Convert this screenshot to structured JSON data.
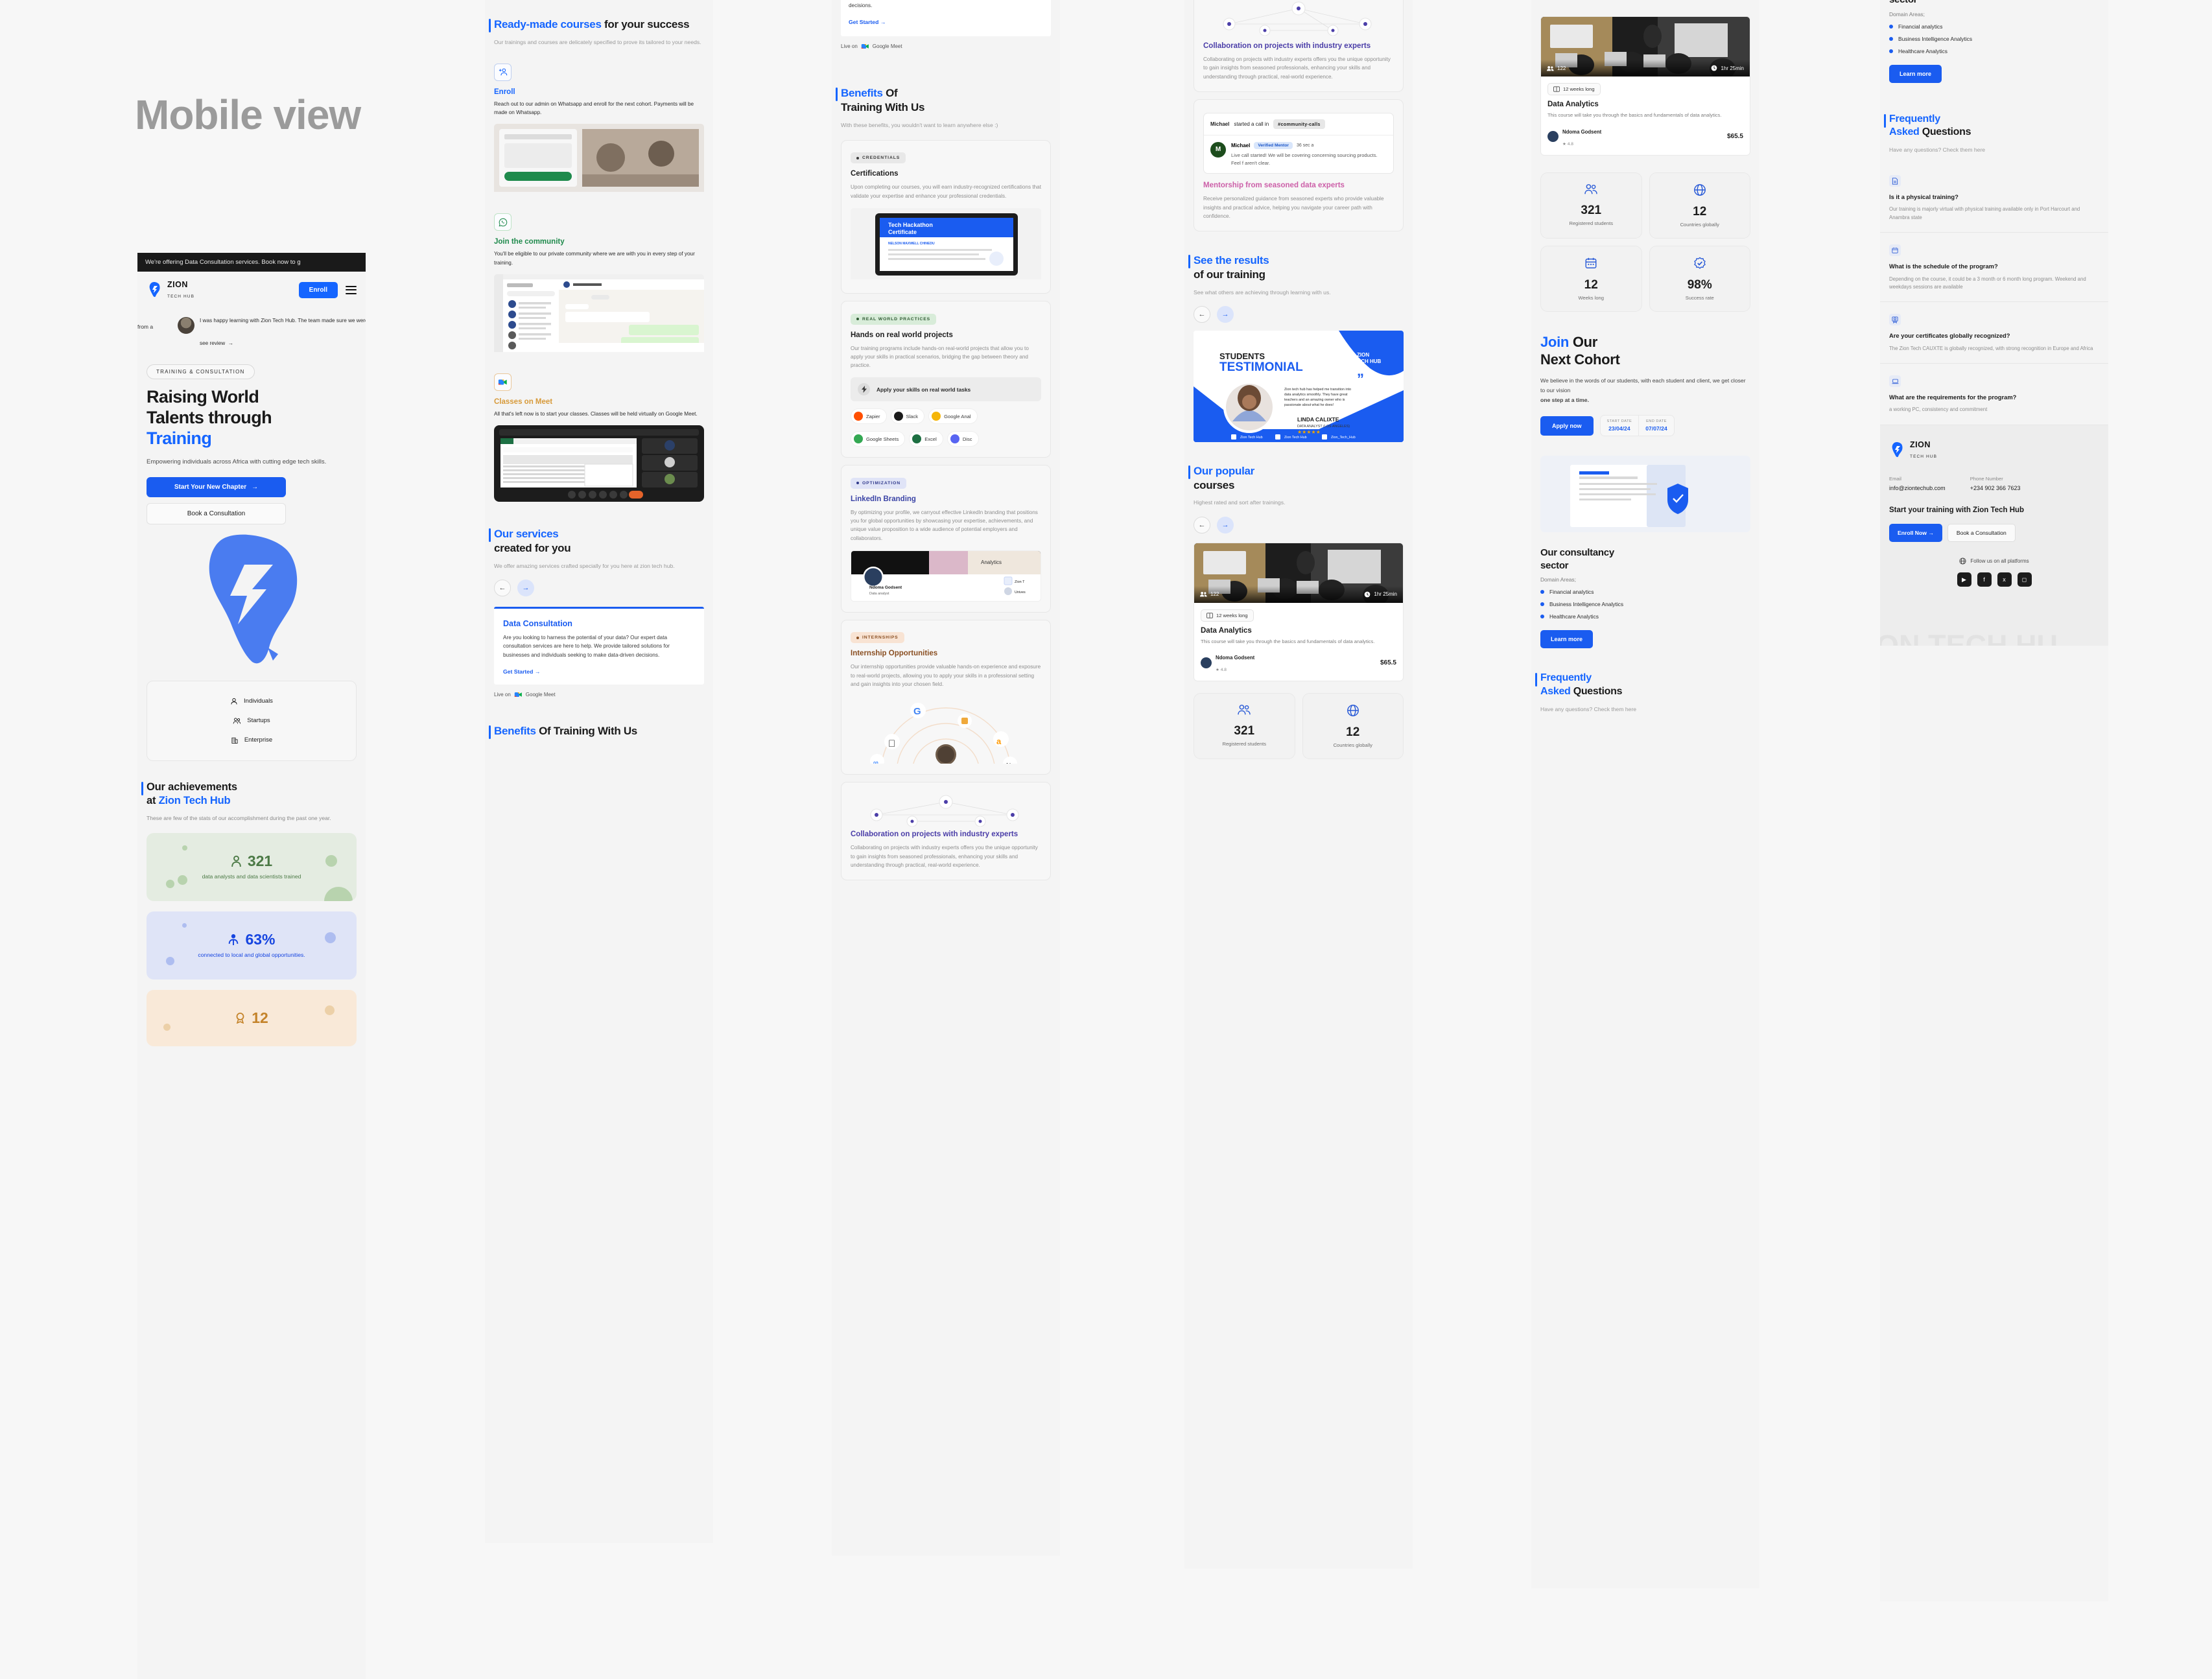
{
  "page_label": "Mobile view",
  "brand": {
    "name_line1": "ZION",
    "name_line2": "TECH HUB",
    "accent": "#1565ff"
  },
  "screen1": {
    "announcement": "We're offering Data Consultation services. Book now to g",
    "nav": {
      "enroll": "Enroll",
      "menu": "menu-icon"
    },
    "review": {
      "left_fragment": "from a",
      "quote": "I  was happy learning with Zion Tech Hub. The team made sure we weren't overwhelmed lea",
      "link": "see review"
    },
    "hero": {
      "eyebrow": "TRAINING & CONSULTATION",
      "title_line1": "Raising World",
      "title_line2": "Talents through",
      "title_accent": "Training",
      "subtitle": "Empowering individuals across Africa with cutting edge tech skills.",
      "cta_primary": "Start Your New Chapter",
      "cta_secondary": "Book a Consultation"
    },
    "audience": [
      {
        "icon": "person-icon",
        "label": "Individuals"
      },
      {
        "icon": "people-icon",
        "label": "Startups"
      },
      {
        "icon": "building-icon",
        "label": "Enterprise"
      }
    ],
    "achievements": {
      "title_plain": "Our achievements",
      "title_at": "at ",
      "title_accent": "Zion Tech Hub",
      "subtitle": "These are few of the stats of our accomplishment during the past one year.",
      "stats": [
        {
          "icon": "person-icon",
          "value": "321",
          "label": "data analysts and data scientists trained",
          "theme": "green"
        },
        {
          "icon": "person-network-icon",
          "value": "63%",
          "label": "connected to local and global opportunities.",
          "theme": "blue"
        },
        {
          "icon": "medal-icon",
          "value": "12",
          "label": "",
          "theme": "orange"
        }
      ]
    }
  },
  "screen2": {
    "heading": {
      "accent": "Ready-made courses",
      "plain": " for your success"
    },
    "subtitle": "Our trainings and courses are delicately specified to prove its tailored to your needs.",
    "steps": [
      {
        "icon": "add-person-icon",
        "title": "Enroll",
        "color": "#1565ff",
        "desc": "Reach out to our admin on Whatsapp and enroll for the next cohort. Payments will be made on Whatsapp."
      },
      {
        "icon": "whatsapp-icon",
        "title": "Join the community",
        "color": "#1f8a4c",
        "desc": "You'll be eligible to our private community where we are with you in every step of your training."
      },
      {
        "icon": "google-meet-icon",
        "title": "Classes on Meet",
        "color": "#d79a3a",
        "desc": "All that's left now is to start your classes. Classes will be held virtually on Google Meet."
      }
    ],
    "services": {
      "heading_accent": "Our services",
      "heading_plain": "created for you",
      "subtitle": "We offer amazing services crafted specially for you here at zion tech hub.",
      "prev": "←",
      "next": "→",
      "card": {
        "title": "Data Consultation",
        "body": "Are you looking to harness the potential of your data? Our expert data consultation services are here to help. We provide tailored solutions for businesses and individuals seeking to make data-driven decisions.",
        "link": "Get Started",
        "live_on": "Live on",
        "live_on_brand": "Google Meet"
      }
    },
    "benefits_heading": {
      "accent": "Benefits",
      "plain": " Of Training With Us"
    }
  },
  "screen3": {
    "data_consultation_peek": {
      "link": "Get Started",
      "live_on": "Live on",
      "live_on_brand": "Google Meet"
    },
    "heading": {
      "accent": "Benefits",
      "plain_l1": " Of",
      "plain_l2": "Training With Us"
    },
    "subtitle": "With these benefits, you wouldn't want to learn anywhere else :)",
    "cards": [
      {
        "tag": "CREDENTIALS",
        "tag_theme": "gray",
        "title": "Certifications",
        "title_theme": "",
        "desc": "Upon completing our courses, you will earn industry-recognized certifications that validate your expertise and enhance your professional credentials.",
        "visual": "certificate-mockup",
        "visual_label": "Tech Hackathon Certificate",
        "visual_sub": "NELSON MAXWELL CHINEDU"
      },
      {
        "tag": "REAL WORLD PRACTICES",
        "tag_theme": "green",
        "title": "Hands on real world projects",
        "title_theme": "",
        "desc": "Our training programs include hands-on real-world projects that allow you to apply your skills in practical scenarios, bridging the gap between theory and practice.",
        "apply_row": "Apply your skills on real world tasks",
        "chips_row1": [
          "Zapier",
          "Slack",
          "Google Anal"
        ],
        "chips_row2": [
          "Google Sheets",
          "Excel",
          "Disc"
        ]
      },
      {
        "tag": "OPTIMIZATION",
        "tag_theme": "indigo",
        "title": "LinkedIn Branding",
        "title_theme": "indigo",
        "desc": "By optimizing your profile, we carryout effective LinkedIn branding that positions you for global opportunities by showcasing your expertise, achievements, and unique value proposition to a wide audience of potential employers and collaborators.",
        "profile_name": "Ndoma Godsent",
        "profile_role": "Data analyst",
        "profile_org": "Zion T",
        "profile_org2": "Unives"
      },
      {
        "tag": "INTERNSHIPS",
        "tag_theme": "peach",
        "title": "Internship Opportunities",
        "title_theme": "brown",
        "desc": "Our internship opportunities provide valuable hands-on experience and exposure to real-world projects, allowing you to apply your skills in a professional setting and gain insights into your chosen field."
      },
      {
        "tag": "",
        "tag_theme": "",
        "title": "Collaboration on projects with industry experts",
        "title_theme": "purple",
        "desc": "Collaborating on projects with industry experts offers you the unique opportunity to gain insights from seasoned professionals, enhancing your skills and understanding through practical, real-world experience."
      }
    ]
  },
  "screen4": {
    "collab_card": {
      "title": "Collaboration on projects with industry experts",
      "desc": "Collaborating on projects with industry experts offers you the unique opportunity to gain insights from seasoned professionals, enhancing your skills and understanding through practical, real-world experience."
    },
    "mentorship_card": {
      "slack": {
        "started_by": "Michael",
        "started_text": "started a call in",
        "channel": "#community-calls",
        "avatar_letter": "M",
        "name": "Michael",
        "badge": "Verified Mentor",
        "time": "36 sec a",
        "message": "Live call started! We will be covering concerning sourcing products. Feel f aren't clear."
      },
      "title": "Mentorship from seasoned data experts",
      "desc": "Receive personalized guidance from seasoned experts who provide valuable insights and practical advice, helping you navigate your career path with confidence."
    },
    "results": {
      "heading_accent": "See the results",
      "heading_plain": "of our training",
      "subtitle": "See what others are achieving through learning with us.",
      "prev": "←",
      "next": "→"
    },
    "testimonial": {
      "kicker": "STUDENTS",
      "title": "TESTIMONIAL",
      "quote": "Zion tech hub has helped me transition into data analytics smoothly. They have great teachers and an amazing owner who is passionate about what he does!",
      "name": "LINDA CALIXTE",
      "role": "DATA ANALYST (LOS ANGELES)",
      "stars": "★★★★★",
      "socials": [
        "Zion Tech Hub",
        "Zion Tech Hub",
        "Zion_Tech_Hub"
      ],
      "brand_l1": "ZION",
      "brand_l2": "TECH HUB"
    },
    "popular": {
      "heading_accent": "Our popular",
      "heading_plain": "courses",
      "subtitle": "Highest rated and sort after trainings.",
      "prev": "←",
      "next": "→"
    },
    "course": {
      "students": "122",
      "duration": "1hr 25min",
      "weeks": "12 weeks long",
      "title": "Data Analytics",
      "desc": "This course will take you through the basics and fundamentals of data analytics.",
      "author": "Ndoma Godsent",
      "rating": "4.8",
      "price": "$65.5"
    },
    "bottom_stats": [
      {
        "icon": "people-icon",
        "value": "321",
        "label": "Registered students"
      },
      {
        "icon": "globe-icon",
        "value": "12",
        "label": "Countries globally"
      }
    ]
  },
  "screen5": {
    "course_card": {
      "students": "122",
      "duration": "1hr 25min",
      "weeks": "12 weeks long",
      "title": "Data Analytics",
      "desc": "This course will take you through the basics and fundamentals of data analytics.",
      "author": "Ndoma Godsent",
      "rating": "4.8",
      "price": "$65.5"
    },
    "stats": [
      {
        "icon": "people-icon",
        "value": "321",
        "label": "Registered students"
      },
      {
        "icon": "globe-icon",
        "value": "12",
        "label": "Countries globally"
      },
      {
        "icon": "calendar-icon",
        "value": "12",
        "label": "Weeks long"
      },
      {
        "icon": "verified-icon",
        "value": "98%",
        "label": "Success rate"
      }
    ],
    "cohort": {
      "heading_accent": "Join",
      "heading_plain_1": " Our",
      "heading_plain_2": "Next Cohort",
      "body": "We believe in the words of our students, with each student and client, we get closer to our vision",
      "body_bold": "one step at a time.",
      "cta": "Apply now",
      "start_label": "START DATE",
      "start_value": "23/04/24",
      "end_label": "END DATE",
      "end_value": "07/07/24"
    },
    "consultancy": {
      "title_l1": "Our consultancy",
      "title_l2": "sector",
      "subtitle": "Domain Areas;",
      "bullets": [
        "Financial analytics",
        "Business Intelligence Analytics",
        "Healthcare Analytics"
      ],
      "cta": "Learn more"
    },
    "faq_heading": {
      "accent": "Frequently",
      "accent2": "Asked",
      "plain": "Questions"
    },
    "faq_sub": "Have any questions? Check them here"
  },
  "screen6": {
    "consultancy": {
      "title_l1": "sector",
      "subtitle": "Domain Areas;",
      "bullets": [
        "Financial analytics",
        "Business Intelligence Analytics",
        "Healthcare Analytics"
      ],
      "cta": "Learn more"
    },
    "faq_heading": {
      "accent": "Frequently",
      "accent2": "Asked",
      "plain": "Questions"
    },
    "faq_sub": "Have any questions? Check them here",
    "faqs": [
      {
        "icon": "document-icon",
        "q": "Is it a physical training?",
        "a": "Our training is majorly virtual with physical training available only in Port Harcourt and Anambra state"
      },
      {
        "icon": "calendar-icon",
        "q": "What is the schedule of the program?",
        "a": "Depending on the course,  it could be a 3 month or 6 month long program. Weekend and weekdays sessions are available"
      },
      {
        "icon": "certificate-icon",
        "q": "Are your certificates globally recognized?",
        "a": "The Zion Tech CAUXTE is globally recognized,  with strong recognition in Europe and Africa"
      },
      {
        "icon": "laptop-icon",
        "q": "What are the requirements for the program?",
        "a": "a working PC, consistency and commitment"
      }
    ],
    "footer": {
      "email_label": "Email",
      "email_value": "info@ziontechub.com",
      "phone_label": "Phone Number",
      "phone_value": "+234 902 366 7623",
      "cta_text": "Start your training with Zion Tech Hub",
      "btn_enroll": "Enroll Now",
      "btn_book": "Book a Consultation",
      "follow": "Follow us on all platforms",
      "socials": [
        "youtube-icon",
        "facebook-icon",
        "twitter-icon",
        "instagram-icon"
      ],
      "watermark": "ON TECH HU"
    }
  }
}
